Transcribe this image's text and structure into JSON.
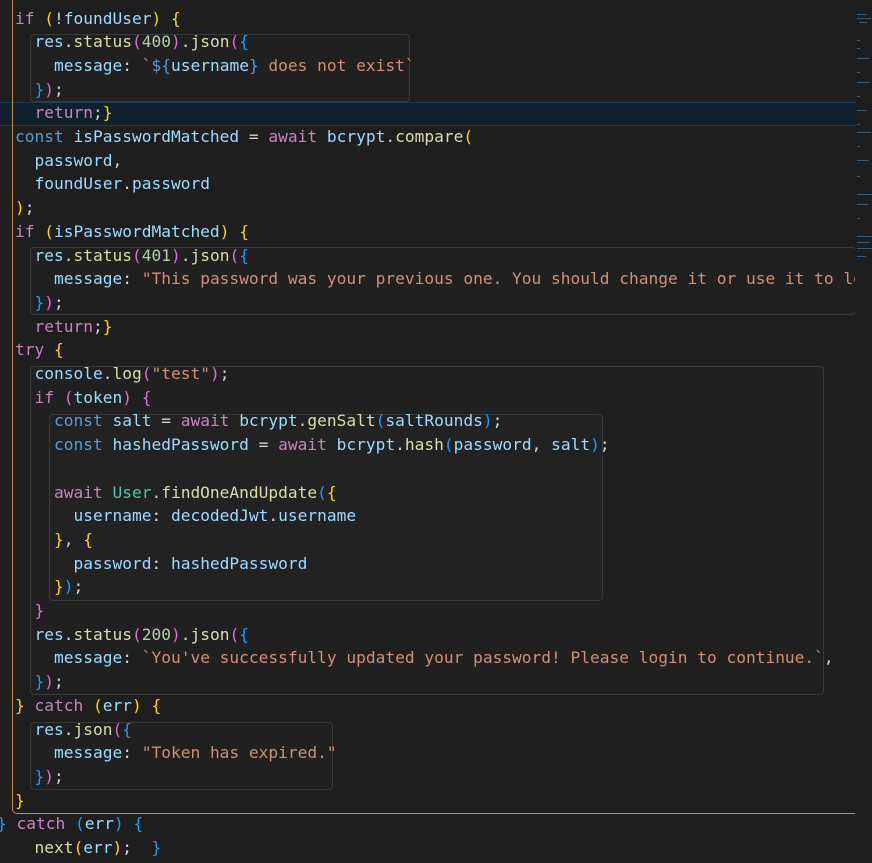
{
  "editor": {
    "lines": [
      [
        [
          "c",
          "if"
        ],
        [
          "p",
          " "
        ],
        [
          "b1",
          "("
        ],
        [
          "p",
          "!"
        ],
        [
          "v",
          "foundUser"
        ],
        [
          "b1",
          ")"
        ],
        [
          "p",
          " "
        ],
        [
          "b1",
          "{"
        ]
      ],
      [
        [
          "p",
          "  "
        ],
        [
          "v",
          "res"
        ],
        [
          "p",
          "."
        ],
        [
          "f",
          "status"
        ],
        [
          "b2",
          "("
        ],
        [
          "n",
          "400"
        ],
        [
          "b2",
          ")"
        ],
        [
          "p",
          "."
        ],
        [
          "f",
          "json"
        ],
        [
          "b2",
          "("
        ],
        [
          "b3",
          "{"
        ]
      ],
      [
        [
          "p",
          "    "
        ],
        [
          "v",
          "message"
        ],
        [
          "p",
          ": "
        ],
        [
          "s",
          "`"
        ],
        [
          "k",
          "${"
        ],
        [
          "v",
          "username"
        ],
        [
          "k",
          "}"
        ],
        [
          "s",
          " does not exist`"
        ]
      ],
      [
        [
          "p",
          "  "
        ],
        [
          "b3",
          "}"
        ],
        [
          "b2",
          ")"
        ],
        [
          "p",
          ";"
        ]
      ],
      [
        [
          "p",
          "  "
        ],
        [
          "c",
          "return"
        ],
        [
          "p",
          ";"
        ],
        [
          "b1",
          "}"
        ]
      ],
      [
        [
          "k",
          "const"
        ],
        [
          "p",
          " "
        ],
        [
          "v",
          "isPasswordMatched"
        ],
        [
          "p",
          " = "
        ],
        [
          "c",
          "await"
        ],
        [
          "p",
          " "
        ],
        [
          "v",
          "bcrypt"
        ],
        [
          "p",
          "."
        ],
        [
          "f",
          "compare"
        ],
        [
          "b1",
          "("
        ]
      ],
      [
        [
          "p",
          "  "
        ],
        [
          "v",
          "password"
        ],
        [
          "p",
          ","
        ]
      ],
      [
        [
          "p",
          "  "
        ],
        [
          "v",
          "foundUser"
        ],
        [
          "p",
          "."
        ],
        [
          "v",
          "password"
        ]
      ],
      [
        [
          "b1",
          ")"
        ],
        [
          "p",
          ";"
        ]
      ],
      [
        [
          "c",
          "if"
        ],
        [
          "p",
          " "
        ],
        [
          "b1",
          "("
        ],
        [
          "v",
          "isPasswordMatched"
        ],
        [
          "b1",
          ")"
        ],
        [
          "p",
          " "
        ],
        [
          "b1",
          "{"
        ]
      ],
      [
        [
          "p",
          "  "
        ],
        [
          "v",
          "res"
        ],
        [
          "p",
          "."
        ],
        [
          "f",
          "status"
        ],
        [
          "b2",
          "("
        ],
        [
          "n",
          "401"
        ],
        [
          "b2",
          ")"
        ],
        [
          "p",
          "."
        ],
        [
          "f",
          "json"
        ],
        [
          "b2",
          "("
        ],
        [
          "b3",
          "{"
        ]
      ],
      [
        [
          "p",
          "    "
        ],
        [
          "v",
          "message"
        ],
        [
          "p",
          ": "
        ],
        [
          "s",
          "\"This password was your previous one. You should change it or use it to lo"
        ]
      ],
      [
        [
          "p",
          "  "
        ],
        [
          "b3",
          "}"
        ],
        [
          "b2",
          ")"
        ],
        [
          "p",
          ";"
        ]
      ],
      [
        [
          "p",
          "  "
        ],
        [
          "c",
          "return"
        ],
        [
          "p",
          ";"
        ],
        [
          "b1",
          "}"
        ]
      ],
      [
        [
          "c",
          "try"
        ],
        [
          "p",
          " "
        ],
        [
          "b1",
          "{"
        ]
      ],
      [
        [
          "p",
          "  "
        ],
        [
          "v",
          "console"
        ],
        [
          "p",
          "."
        ],
        [
          "f",
          "log"
        ],
        [
          "b2",
          "("
        ],
        [
          "s",
          "\"test\""
        ],
        [
          "b2",
          ")"
        ],
        [
          "p",
          ";"
        ]
      ],
      [
        [
          "p",
          "  "
        ],
        [
          "c",
          "if"
        ],
        [
          "p",
          " "
        ],
        [
          "b2",
          "("
        ],
        [
          "v",
          "token"
        ],
        [
          "b2",
          ")"
        ],
        [
          "p",
          " "
        ],
        [
          "b2",
          "{"
        ]
      ],
      [
        [
          "p",
          "    "
        ],
        [
          "k",
          "const"
        ],
        [
          "p",
          " "
        ],
        [
          "v",
          "salt"
        ],
        [
          "p",
          " = "
        ],
        [
          "c",
          "await"
        ],
        [
          "p",
          " "
        ],
        [
          "v",
          "bcrypt"
        ],
        [
          "p",
          "."
        ],
        [
          "f",
          "genSalt"
        ],
        [
          "b3",
          "("
        ],
        [
          "v",
          "saltRounds"
        ],
        [
          "b3",
          ")"
        ],
        [
          "p",
          ";"
        ]
      ],
      [
        [
          "p",
          "    "
        ],
        [
          "k",
          "const"
        ],
        [
          "p",
          " "
        ],
        [
          "v",
          "hashedPassword"
        ],
        [
          "p",
          " = "
        ],
        [
          "c",
          "await"
        ],
        [
          "p",
          " "
        ],
        [
          "v",
          "bcrypt"
        ],
        [
          "p",
          "."
        ],
        [
          "f",
          "hash"
        ],
        [
          "b3",
          "("
        ],
        [
          "v",
          "password"
        ],
        [
          "p",
          ", "
        ],
        [
          "v",
          "salt"
        ],
        [
          "b3",
          ")"
        ],
        [
          "p",
          ";"
        ]
      ],
      [
        [
          "p",
          ""
        ]
      ],
      [
        [
          "p",
          "    "
        ],
        [
          "c",
          "await"
        ],
        [
          "p",
          " "
        ],
        [
          "t",
          "User"
        ],
        [
          "p",
          "."
        ],
        [
          "f",
          "findOneAndUpdate"
        ],
        [
          "b3",
          "("
        ],
        [
          "b1",
          "{"
        ]
      ],
      [
        [
          "p",
          "      "
        ],
        [
          "v",
          "username"
        ],
        [
          "p",
          ": "
        ],
        [
          "v",
          "decodedJwt"
        ],
        [
          "p",
          "."
        ],
        [
          "v",
          "username"
        ]
      ],
      [
        [
          "p",
          "    "
        ],
        [
          "b1",
          "}"
        ],
        [
          "p",
          ", "
        ],
        [
          "b1",
          "{"
        ]
      ],
      [
        [
          "p",
          "      "
        ],
        [
          "v",
          "password"
        ],
        [
          "p",
          ": "
        ],
        [
          "v",
          "hashedPassword"
        ]
      ],
      [
        [
          "p",
          "    "
        ],
        [
          "b1",
          "}"
        ],
        [
          "b3",
          ")"
        ],
        [
          "p",
          ";"
        ]
      ],
      [
        [
          "p",
          "  "
        ],
        [
          "b2",
          "}"
        ]
      ],
      [
        [
          "p",
          "  "
        ],
        [
          "v",
          "res"
        ],
        [
          "p",
          "."
        ],
        [
          "f",
          "status"
        ],
        [
          "b2",
          "("
        ],
        [
          "n",
          "200"
        ],
        [
          "b2",
          ")"
        ],
        [
          "p",
          "."
        ],
        [
          "f",
          "json"
        ],
        [
          "b2",
          "("
        ],
        [
          "b3",
          "{"
        ]
      ],
      [
        [
          "p",
          "    "
        ],
        [
          "v",
          "message"
        ],
        [
          "p",
          ": "
        ],
        [
          "s",
          "`You've successfully updated your password! Please login to continue.`"
        ],
        [
          "p",
          ","
        ]
      ],
      [
        [
          "p",
          "  "
        ],
        [
          "b3",
          "}"
        ],
        [
          "b2",
          ")"
        ],
        [
          "p",
          ";"
        ]
      ],
      [
        [
          "b1",
          "}"
        ],
        [
          "p",
          " "
        ],
        [
          "c",
          "catch"
        ],
        [
          "p",
          " "
        ],
        [
          "b1",
          "("
        ],
        [
          "v",
          "err"
        ],
        [
          "b1",
          ")"
        ],
        [
          "p",
          " "
        ],
        [
          "b1",
          "{"
        ]
      ],
      [
        [
          "p",
          "  "
        ],
        [
          "v",
          "res"
        ],
        [
          "p",
          "."
        ],
        [
          "f",
          "json"
        ],
        [
          "b2",
          "("
        ],
        [
          "b3",
          "{"
        ]
      ],
      [
        [
          "p",
          "    "
        ],
        [
          "v",
          "message"
        ],
        [
          "p",
          ": "
        ],
        [
          "s",
          "\"Token has expired.\""
        ]
      ],
      [
        [
          "p",
          "  "
        ],
        [
          "b3",
          "}"
        ],
        [
          "b2",
          ")"
        ],
        [
          "p",
          ";"
        ]
      ],
      [
        [
          "b1",
          "}"
        ]
      ],
      [
        [
          "b3",
          "}"
        ],
        [
          "p",
          " "
        ],
        [
          "c",
          "catch"
        ],
        [
          "p",
          " "
        ],
        [
          "b3",
          "("
        ],
        [
          "v",
          "err"
        ],
        [
          "b3",
          ")"
        ],
        [
          "p",
          " "
        ],
        [
          "b3",
          "{"
        ]
      ],
      [
        [
          "p",
          "  "
        ],
        [
          "f",
          "next"
        ],
        [
          "b1",
          "("
        ],
        [
          "v",
          "err"
        ],
        [
          "b1",
          ")"
        ],
        [
          "p",
          ";  "
        ],
        [
          "b3",
          "}"
        ]
      ]
    ]
  }
}
